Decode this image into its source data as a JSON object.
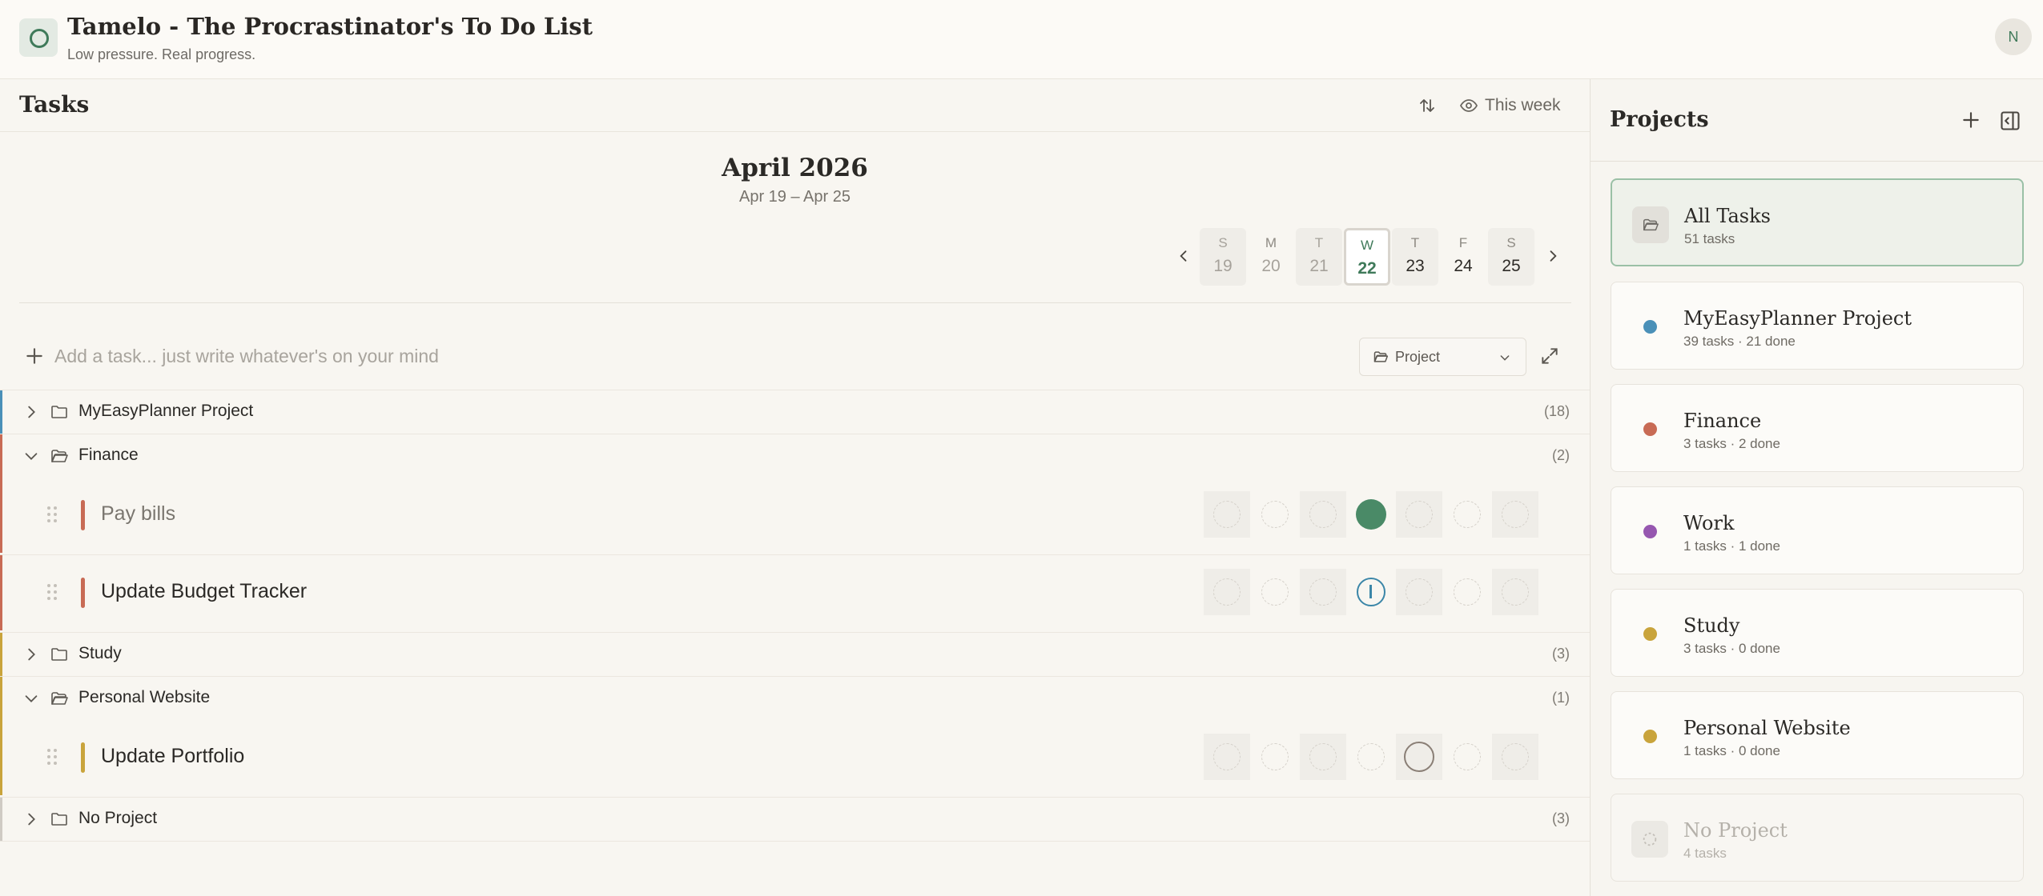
{
  "header": {
    "title": "Tamelo - The Procrastinator's To Do List",
    "subtitle": "Low pressure. Real progress.",
    "avatar_initial": "N"
  },
  "tasks_panel": {
    "title": "Tasks",
    "view_label": "This week",
    "month": "April 2026",
    "range": "Apr 19 – Apr 25",
    "days": [
      {
        "letter": "S",
        "num": "19"
      },
      {
        "letter": "M",
        "num": "20"
      },
      {
        "letter": "T",
        "num": "21"
      },
      {
        "letter": "W",
        "num": "22"
      },
      {
        "letter": "T",
        "num": "23"
      },
      {
        "letter": "F",
        "num": "24"
      },
      {
        "letter": "S",
        "num": "25"
      }
    ],
    "add_placeholder": "Add a task... just write whatever's on your mind",
    "project_select": "Project",
    "groups": [
      {
        "name": "MyEasyPlanner Project",
        "count": "(18)",
        "color": "#4a90b8"
      },
      {
        "name": "Finance",
        "count": "(2)",
        "color": "#c86b55"
      },
      {
        "name": "Study",
        "count": "(3)",
        "color": "#c9a43c"
      },
      {
        "name": "Personal Website",
        "count": "(1)",
        "color": "#c9a43c"
      },
      {
        "name": "No Project",
        "count": "(3)",
        "color": "#cfcbc4"
      }
    ],
    "tasks": [
      {
        "name": "Pay bills",
        "color": "#c86b55",
        "status": [
          "empty",
          "empty",
          "empty",
          "done",
          "empty",
          "empty",
          "empty"
        ]
      },
      {
        "name": "Update Budget Tracker",
        "color": "#c86b55",
        "status": [
          "empty",
          "empty",
          "empty",
          "in-progress",
          "empty",
          "empty",
          "empty"
        ]
      },
      {
        "name": "Update Portfolio",
        "color": "#c9a43c",
        "status": [
          "empty",
          "empty",
          "empty",
          "empty",
          "target",
          "empty",
          "empty"
        ]
      }
    ]
  },
  "projects_panel": {
    "title": "Projects",
    "items": [
      {
        "name": "All Tasks",
        "meta": "51 tasks",
        "color": "#8a8680"
      },
      {
        "name": "MyEasyPlanner Project",
        "meta": "39 tasks · 21 done",
        "color": "#4a90b8"
      },
      {
        "name": "Finance",
        "meta": "3 tasks · 2 done",
        "color": "#c86b55"
      },
      {
        "name": "Work",
        "meta": "1 tasks · 1 done",
        "color": "#9657b0"
      },
      {
        "name": "Study",
        "meta": "3 tasks · 0 done",
        "color": "#c9a43c"
      },
      {
        "name": "Personal Website",
        "meta": "1 tasks · 0 done",
        "color": "#c9a43c"
      },
      {
        "name": "No Project",
        "meta": "4 tasks",
        "color": "#cfcbc4"
      }
    ]
  }
}
